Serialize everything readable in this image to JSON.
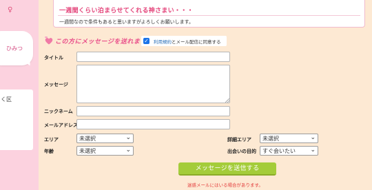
{
  "sidebar": {
    "symbol": "♀",
    "bubble_text": "ひみつ",
    "box_text": "く区"
  },
  "post": {
    "title": "一週間くらい泊まらせてくれる神さまい・・・",
    "body": "一週間なので条件もあると思いますがよろしくお願いします。"
  },
  "form": {
    "heading": "この方にメッセージを送れます",
    "agree": {
      "checked": true,
      "link_text": "利用規約",
      "rest_text": "とメール配信に同意する"
    },
    "labels": {
      "title": "タイトル",
      "message": "メッセージ",
      "nickname": "ニックネーム",
      "email": "メールアドレス",
      "area": "エリア",
      "detail_area": "詳細エリア",
      "age": "年齢",
      "purpose": "出会いの目的"
    },
    "values": {
      "title": "",
      "message": "",
      "nickname": "",
      "email": ""
    },
    "selects": {
      "area": "未選択",
      "detail_area": "未選択",
      "age": "未選択",
      "purpose": "すぐ会いたい"
    },
    "submit_label": "メッセージを送信する",
    "spam_note": "迷惑メールにはいる場合があります。"
  },
  "colors": {
    "background": "#fde9d3",
    "sidebar": "#fcd2df",
    "accent_pink": "#e94f8a",
    "submit_green": "#a4cc3a",
    "warning_red": "#e23a3a"
  },
  "icons": {
    "heading": "heart-icon",
    "select": "chevron-down-icon"
  }
}
